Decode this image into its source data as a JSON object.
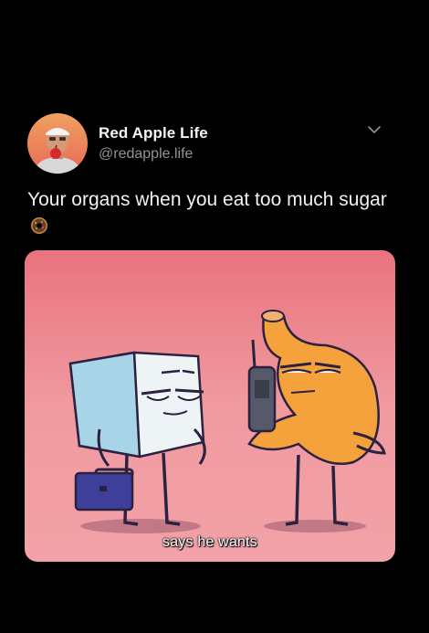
{
  "author": {
    "display_name": "Red Apple Life",
    "handle": "@redapple.life",
    "avatar_icon": "profile-photo"
  },
  "menu": {
    "icon": "chevron-down-icon"
  },
  "tweet": {
    "text": "Your organs when you eat too much sugar",
    "emoji_icon": "donut-icon"
  },
  "media": {
    "caption": "says he wants",
    "colors": {
      "background_top": "#e9737e",
      "background_bottom": "#f2a2a8",
      "stomach": "#f5a13c",
      "sugar_cube": "#eef3f6",
      "briefcase": "#3d3f9a"
    }
  },
  "theme": {
    "background": "#000000",
    "text": "#f2f2f2",
    "secondary_text": "#8f9499"
  }
}
